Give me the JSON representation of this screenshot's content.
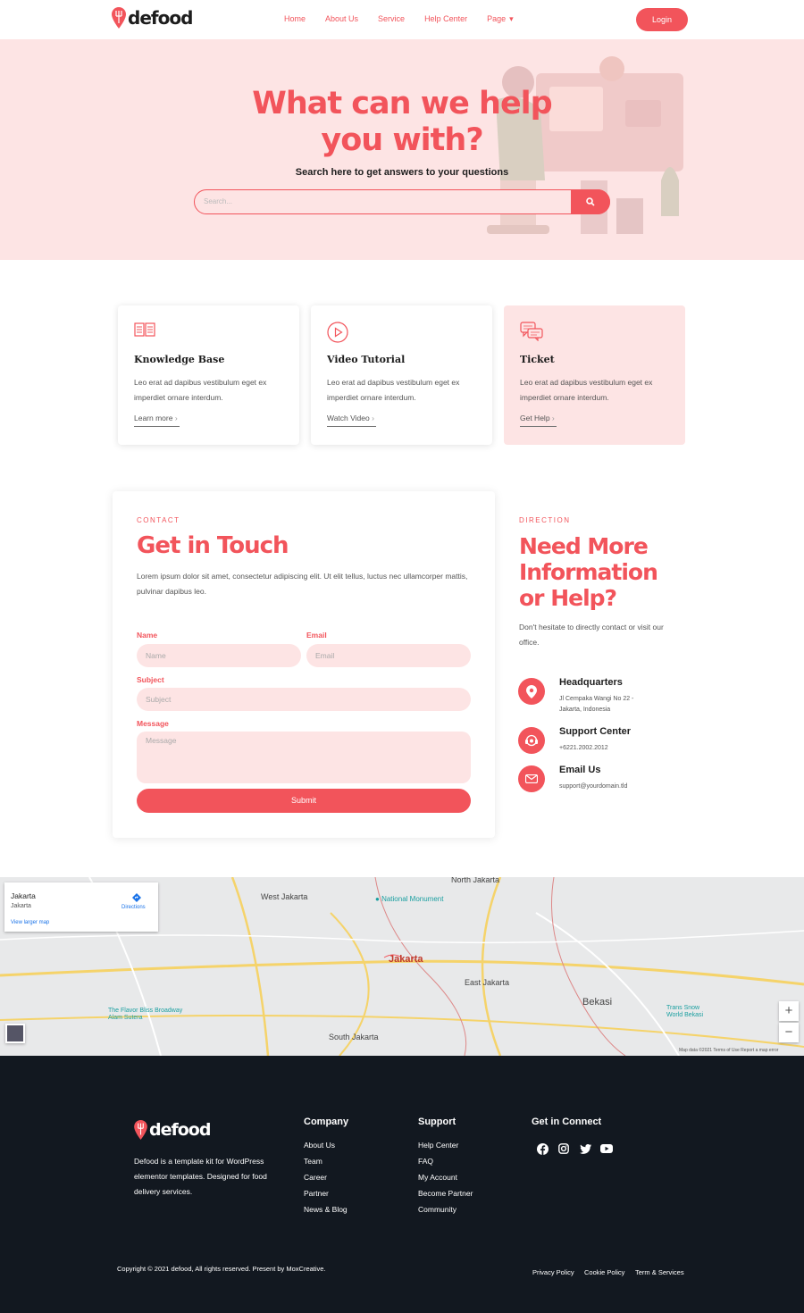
{
  "brand": {
    "name": "defood",
    "accent": "#f2545b",
    "hero_bg": "#fde4e4",
    "footer_bg": "#121820"
  },
  "nav": {
    "items": [
      "Home",
      "About Us",
      "Service",
      "Help Center",
      "Page"
    ],
    "login": "Login"
  },
  "hero": {
    "title": "What can we help you with?",
    "subtitle": "Search here to get answers to your questions",
    "search_placeholder": "Search..."
  },
  "cards": [
    {
      "title": "Knowledge Base",
      "text": "Leo erat ad dapibus vestibulum eget ex imperdiet ornare interdum.",
      "link": "Learn more",
      "icon": "book-icon"
    },
    {
      "title": "Video Tutorial",
      "text": "Leo erat ad dapibus vestibulum eget ex imperdiet ornare interdum.",
      "link": "Watch Video",
      "icon": "play-icon"
    },
    {
      "title": "Ticket",
      "text": "Leo erat ad dapibus vestibulum eget ex imperdiet ornare interdum.",
      "link": "Get Help",
      "icon": "chat-icon"
    }
  ],
  "contact": {
    "eyebrow": "CONTACT",
    "title": "Get in Touch",
    "text": "Lorem ipsum dolor sit amet, consectetur adipiscing elit. Ut elit tellus, luctus nec ullamcorper mattis, pulvinar dapibus leo.",
    "name_label": "Name",
    "name_placeholder": "Name",
    "email_label": "Email",
    "email_placeholder": "Email",
    "subject_label": "Subject",
    "subject_placeholder": "Subject",
    "message_label": "Message",
    "message_placeholder": "Message",
    "submit": "Submit"
  },
  "direction": {
    "eyebrow": "DIRECTION",
    "title": "Need More Information or Help?",
    "text": "Don't hesitate to directly contact or visit our office.",
    "items": [
      {
        "title": "Headquarters",
        "text": "Jl Cempaka Wangi No 22 - Jakarta, Indonesia",
        "icon": "location-pin-icon"
      },
      {
        "title": "Support Center",
        "text": "+6221.2002.2012",
        "icon": "headset-icon"
      },
      {
        "title": "Email Us",
        "text": "support@yourdomain.tld",
        "icon": "mail-icon"
      }
    ]
  },
  "map": {
    "card_title": "Jakarta",
    "card_sub": "Jakarta",
    "directions": "Directions",
    "larger_map": "View larger map",
    "labels": {
      "north": "North Jakarta",
      "west": "West Jakarta",
      "center": "Jakarta",
      "east": "East Jakarta",
      "south": "South Jakarta",
      "bekasi": "Bekasi",
      "monument": "National Monument",
      "flavor": "The Flavor Bliss Broadway Alam Sutera",
      "trans": "Trans Snow World Bekasi"
    },
    "footer_text": "Map data ©2021   Terms of Use   Report a map error",
    "zoom_in": "+",
    "zoom_out": "−"
  },
  "footer": {
    "tagline": "Defood is a template kit for WordPress elementor templates. Designed for food delivery services.",
    "company_title": "Company",
    "company_links": [
      "About Us",
      "Team",
      "Career",
      "Partner",
      "News & Blog"
    ],
    "support_title": "Support",
    "support_links": [
      "Help Center",
      "FAQ",
      "My Account",
      "Become Partner",
      "Community"
    ],
    "connect_title": "Get in Connect",
    "social": [
      "facebook-icon",
      "instagram-icon",
      "twitter-icon",
      "youtube-icon"
    ],
    "copyright": "Copyright © 2021 defood, All rights reserved. Present by MoxCreative.",
    "legal": [
      "Privacy Policy",
      "Cookie Policy",
      "Term & Services"
    ]
  }
}
